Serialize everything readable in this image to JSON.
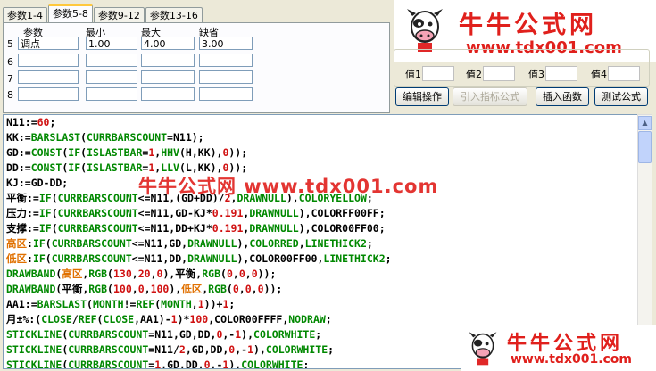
{
  "tabs": [
    "参数1-4",
    "参数5-8",
    "参数9-12",
    "参数13-16"
  ],
  "params": {
    "headers": [
      "参数",
      "最小",
      "最大",
      "缺省"
    ],
    "rows": [
      {
        "num": "5",
        "name": "调点",
        "min": "1.00",
        "max": "4.00",
        "def": "3.00"
      },
      {
        "num": "6",
        "name": "",
        "min": "",
        "max": "",
        "def": ""
      },
      {
        "num": "7",
        "name": "",
        "min": "",
        "max": "",
        "def": ""
      },
      {
        "num": "8",
        "name": "",
        "min": "",
        "max": "",
        "def": ""
      }
    ]
  },
  "values": [
    "值1",
    "值2",
    "值3",
    "值4"
  ],
  "buttons": {
    "edit": "编辑操作",
    "import": "引入指标公式",
    "insert": "插入函数",
    "test": "测试公式"
  },
  "logo": {
    "title": "牛牛公式网",
    "url": "www.tdx001.com"
  },
  "watermark": "牛牛公式网 www.tdx001.com",
  "code": [
    "N11:=60;",
    "KK:=BARSLAST(CURRBARSCOUNT=N11);",
    "GD:=CONST(IF(ISLASTBAR=1,HHV(H,KK),0));",
    "DD:=CONST(IF(ISLASTBAR=1,LLV(L,KK),0));",
    "KJ:=GD-DD;",
    "平衡:=IF(CURRBARSCOUNT<=N11,(GD+DD)/2,DRAWNULL),COLORYELLOW;",
    "压力:=IF(CURRBARSCOUNT<=N11,GD-KJ*0.191,DRAWNULL),COLORFF00FF;",
    "支撑:=IF(CURRBARSCOUNT<=N11,DD+KJ*0.191,DRAWNULL),COLOR00FF00;",
    "高区:IF(CURRBARSCOUNT<=N11,GD,DRAWNULL),COLORRED,LINETHICK2;",
    "低区:IF(CURRBARSCOUNT<=N11,DD,DRAWNULL),COLOR00FF00,LINETHICK2;",
    "DRAWBAND(高区,RGB(130,20,0),平衡,RGB(0,0,0));",
    "DRAWBAND(平衡,RGB(100,0,100),低区,RGB(0,0,0));",
    "AA1:=BARSLAST(MONTH!=REF(MONTH,1))+1;",
    "月±%:(CLOSE/REF(CLOSE,AA1)-1)*100,COLOR00FFFF,NODRAW;",
    "STICKLINE(CURRBARSCOUNT=N11,GD,DD,0,-1),COLORWHITE;",
    "STICKLINE(CURRBARSCOUNT=N11/2,GD,DD,0,-1),COLORWHITE;",
    "STICKLINE(CURRBARSCOUNT=1,GD,DD,0,-1),COLORWHITE;"
  ]
}
